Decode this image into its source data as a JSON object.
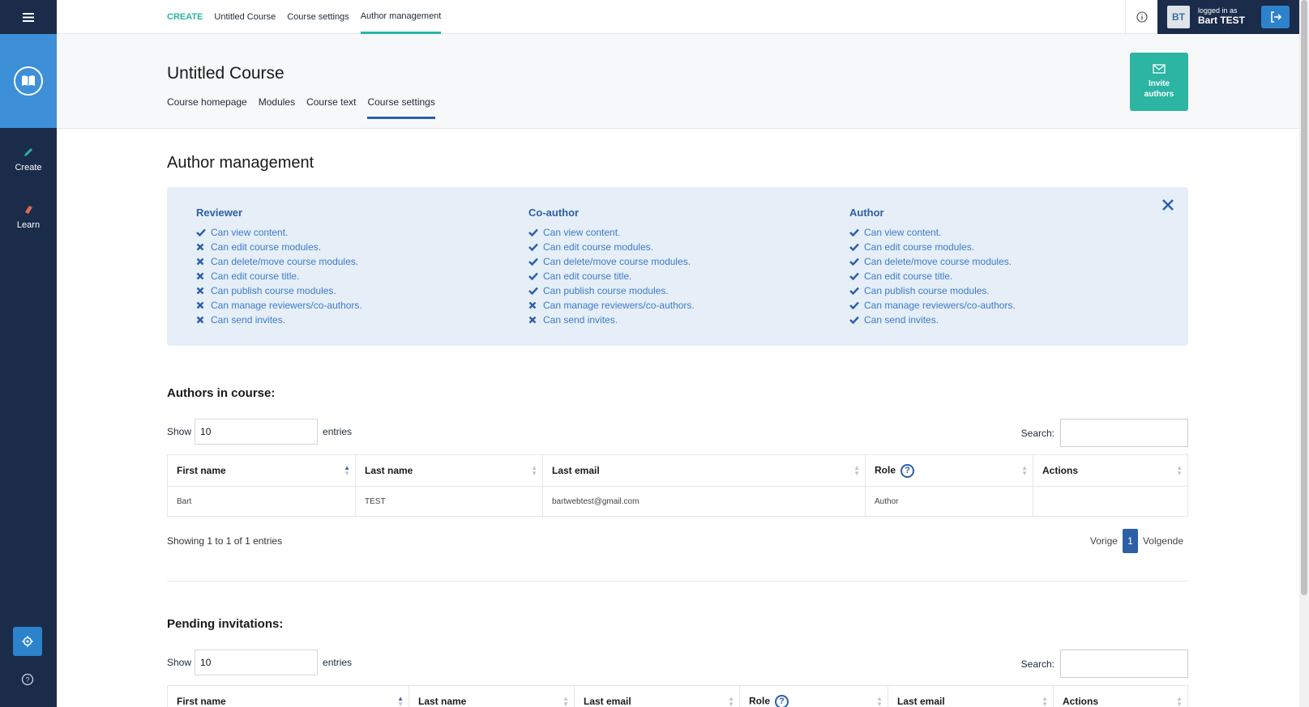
{
  "topbar": {
    "crumbs": [
      "CREATE",
      "Untitled Course",
      "Course settings",
      "Author management"
    ],
    "user_small": "logged in as",
    "user_name": "Bart TEST",
    "avatar_initials": "BT"
  },
  "sidebar": {
    "create_label": "Create",
    "learn_label": "Learn"
  },
  "header": {
    "course_title": "Untitled Course",
    "tabs": [
      "Course homepage",
      "Modules",
      "Course text",
      "Course settings"
    ],
    "invite_line1": "Invite",
    "invite_line2": "authors"
  },
  "section_title": "Author management",
  "roles": [
    {
      "name": "Reviewer",
      "perms": [
        {
          "text": "Can view content.",
          "ok": true
        },
        {
          "text": "Can edit course modules.",
          "ok": false
        },
        {
          "text": "Can delete/move course modules.",
          "ok": false
        },
        {
          "text": "Can edit course title.",
          "ok": false
        },
        {
          "text": "Can publish course modules.",
          "ok": false
        },
        {
          "text": "Can manage reviewers/co-authors.",
          "ok": false
        },
        {
          "text": "Can send invites.",
          "ok": false
        }
      ]
    },
    {
      "name": "Co-author",
      "perms": [
        {
          "text": "Can view content.",
          "ok": true
        },
        {
          "text": "Can edit course modules.",
          "ok": true
        },
        {
          "text": "Can delete/move course modules.",
          "ok": true
        },
        {
          "text": "Can edit course title.",
          "ok": true
        },
        {
          "text": "Can publish course modules.",
          "ok": true
        },
        {
          "text": "Can manage reviewers/co-authors.",
          "ok": false
        },
        {
          "text": "Can send invites.",
          "ok": false
        }
      ]
    },
    {
      "name": "Author",
      "perms": [
        {
          "text": "Can view content.",
          "ok": true
        },
        {
          "text": "Can edit course modules.",
          "ok": true
        },
        {
          "text": "Can delete/move course modules.",
          "ok": true
        },
        {
          "text": "Can edit course title.",
          "ok": true
        },
        {
          "text": "Can publish course modules.",
          "ok": true
        },
        {
          "text": "Can manage reviewers/co-authors.",
          "ok": true
        },
        {
          "text": "Can send invites.",
          "ok": true
        }
      ]
    }
  ],
  "authors": {
    "title": "Authors in course:",
    "show_label": "Show",
    "entries_label": "entries",
    "show_value": "10",
    "search_label": "Search:",
    "columns": [
      "First name",
      "Last name",
      "Last email",
      "Role",
      "Actions"
    ],
    "rows": [
      [
        "Bart",
        "TEST",
        "bartwebtest@gmail.com",
        "Author",
        ""
      ]
    ],
    "showing": "Showing 1 to 1 of 1 entries",
    "prev": "Vorige",
    "page": "1",
    "next": "Volgende"
  },
  "pending": {
    "title": "Pending invitations:",
    "show_label": "Show",
    "entries_label": "entries",
    "show_value": "10",
    "search_label": "Search:",
    "columns": [
      "First name",
      "Last name",
      "Last email",
      "Role",
      "Last email",
      "Actions"
    ]
  },
  "colors": {
    "sidebar": "#1b2b4a",
    "brand_blue": "#3d8fd8",
    "accent_teal": "#2bb5a2",
    "role_blue": "#2d5fa8"
  }
}
